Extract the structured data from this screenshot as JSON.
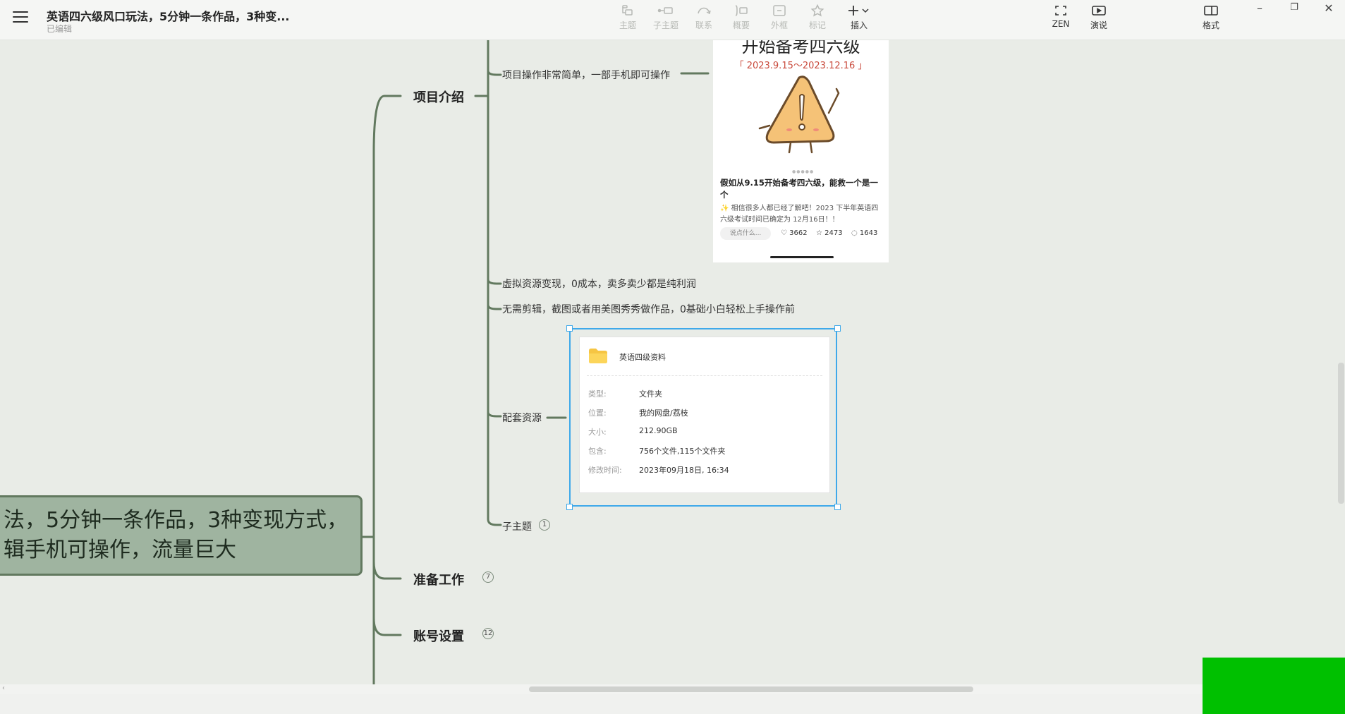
{
  "header": {
    "title": "英语四六级风口玩法，5分钟一条作品，3种变...",
    "status": "已编辑",
    "tools": [
      {
        "label": "主题",
        "icon": "topic-icon"
      },
      {
        "label": "子主题",
        "icon": "subtopic-icon"
      },
      {
        "label": "联系",
        "icon": "relationship-icon"
      },
      {
        "label": "概要",
        "icon": "summary-icon"
      },
      {
        "label": "外框",
        "icon": "boundary-icon"
      },
      {
        "label": "标记",
        "icon": "star-icon"
      },
      {
        "label": "插入",
        "icon": "plus-icon"
      }
    ],
    "right_tools": [
      {
        "label": "ZEN",
        "icon": "fullscreen-icon"
      },
      {
        "label": "演说",
        "icon": "presentation-icon"
      },
      {
        "label": "格式",
        "icon": "format-panel-icon"
      }
    ]
  },
  "mindmap": {
    "central": {
      "line1": "法，5分钟一条作品，3种变现方式，",
      "line2": "辑手机可操作，流量巨大"
    },
    "branches": [
      {
        "label": "项目介绍"
      },
      {
        "label": "准备工作",
        "count": "7"
      },
      {
        "label": "账号设置",
        "count": "12"
      }
    ],
    "subtopics": [
      {
        "label": "项目操作非常简单，一部手机即可操作"
      },
      {
        "label": "虚拟资源变现，0成本，卖多卖少都是纯利润"
      },
      {
        "label": "无需剪辑，截图或者用美图秀秀做作品，0基础小白轻松上手操作前"
      },
      {
        "label": "配套资源"
      },
      {
        "label": "子主题",
        "count": "1"
      }
    ],
    "phone_image": {
      "title": "开始备考四六级",
      "date": "「 2023.9.15～2023.12.16 」",
      "caption": "假如从9.15开始备考四六级，能救一个是一个",
      "desc": "✨ 相信很多人都已经了解吧！2023 下半年英语四六级考试时间已确定为 12月16日！！",
      "comment_placeholder": "说点什么...",
      "likes": "3662",
      "stars": "2473",
      "comments": "1643",
      "accent": "#c94a3c"
    },
    "file_card": {
      "name": "英语四级资料",
      "rows": [
        {
          "key": "类型:",
          "value": "文件夹"
        },
        {
          "key": "位置:",
          "value": "我的网盘/荔枝"
        },
        {
          "key": "大小:",
          "value": "212.90GB"
        },
        {
          "key": "包含:",
          "value": "756个文件,115个文件夹"
        },
        {
          "key": "修改时间:",
          "value": "2023年09月18日, 16:34"
        }
      ],
      "selection_color": "#3fa9ea"
    }
  },
  "colors": {
    "canvas": "#e9ece7",
    "central_fill": "#9fb4a0",
    "line": "#62795f",
    "overlay": "#00c000"
  }
}
